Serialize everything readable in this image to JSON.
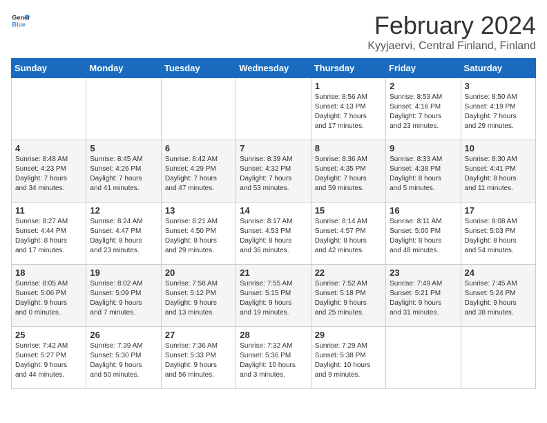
{
  "header": {
    "logo_line1": "General",
    "logo_line2": "Blue",
    "month_year": "February 2024",
    "location": "Kyyjaervi, Central Finland, Finland"
  },
  "weekdays": [
    "Sunday",
    "Monday",
    "Tuesday",
    "Wednesday",
    "Thursday",
    "Friday",
    "Saturday"
  ],
  "weeks": [
    [
      {
        "day": "",
        "info": ""
      },
      {
        "day": "",
        "info": ""
      },
      {
        "day": "",
        "info": ""
      },
      {
        "day": "",
        "info": ""
      },
      {
        "day": "1",
        "info": "Sunrise: 8:56 AM\nSunset: 4:13 PM\nDaylight: 7 hours\nand 17 minutes."
      },
      {
        "day": "2",
        "info": "Sunrise: 8:53 AM\nSunset: 4:16 PM\nDaylight: 7 hours\nand 23 minutes."
      },
      {
        "day": "3",
        "info": "Sunrise: 8:50 AM\nSunset: 4:19 PM\nDaylight: 7 hours\nand 29 minutes."
      }
    ],
    [
      {
        "day": "4",
        "info": "Sunrise: 8:48 AM\nSunset: 4:23 PM\nDaylight: 7 hours\nand 34 minutes."
      },
      {
        "day": "5",
        "info": "Sunrise: 8:45 AM\nSunset: 4:26 PM\nDaylight: 7 hours\nand 41 minutes."
      },
      {
        "day": "6",
        "info": "Sunrise: 8:42 AM\nSunset: 4:29 PM\nDaylight: 7 hours\nand 47 minutes."
      },
      {
        "day": "7",
        "info": "Sunrise: 8:39 AM\nSunset: 4:32 PM\nDaylight: 7 hours\nand 53 minutes."
      },
      {
        "day": "8",
        "info": "Sunrise: 8:36 AM\nSunset: 4:35 PM\nDaylight: 7 hours\nand 59 minutes."
      },
      {
        "day": "9",
        "info": "Sunrise: 8:33 AM\nSunset: 4:38 PM\nDaylight: 8 hours\nand 5 minutes."
      },
      {
        "day": "10",
        "info": "Sunrise: 8:30 AM\nSunset: 4:41 PM\nDaylight: 8 hours\nand 11 minutes."
      }
    ],
    [
      {
        "day": "11",
        "info": "Sunrise: 8:27 AM\nSunset: 4:44 PM\nDaylight: 8 hours\nand 17 minutes."
      },
      {
        "day": "12",
        "info": "Sunrise: 8:24 AM\nSunset: 4:47 PM\nDaylight: 8 hours\nand 23 minutes."
      },
      {
        "day": "13",
        "info": "Sunrise: 8:21 AM\nSunset: 4:50 PM\nDaylight: 8 hours\nand 29 minutes."
      },
      {
        "day": "14",
        "info": "Sunrise: 8:17 AM\nSunset: 4:53 PM\nDaylight: 8 hours\nand 36 minutes."
      },
      {
        "day": "15",
        "info": "Sunrise: 8:14 AM\nSunset: 4:57 PM\nDaylight: 8 hours\nand 42 minutes."
      },
      {
        "day": "16",
        "info": "Sunrise: 8:11 AM\nSunset: 5:00 PM\nDaylight: 8 hours\nand 48 minutes."
      },
      {
        "day": "17",
        "info": "Sunrise: 8:08 AM\nSunset: 5:03 PM\nDaylight: 8 hours\nand 54 minutes."
      }
    ],
    [
      {
        "day": "18",
        "info": "Sunrise: 8:05 AM\nSunset: 5:06 PM\nDaylight: 9 hours\nand 0 minutes."
      },
      {
        "day": "19",
        "info": "Sunrise: 8:02 AM\nSunset: 5:09 PM\nDaylight: 9 hours\nand 7 minutes."
      },
      {
        "day": "20",
        "info": "Sunrise: 7:58 AM\nSunset: 5:12 PM\nDaylight: 9 hours\nand 13 minutes."
      },
      {
        "day": "21",
        "info": "Sunrise: 7:55 AM\nSunset: 5:15 PM\nDaylight: 9 hours\nand 19 minutes."
      },
      {
        "day": "22",
        "info": "Sunrise: 7:52 AM\nSunset: 5:18 PM\nDaylight: 9 hours\nand 25 minutes."
      },
      {
        "day": "23",
        "info": "Sunrise: 7:49 AM\nSunset: 5:21 PM\nDaylight: 9 hours\nand 31 minutes."
      },
      {
        "day": "24",
        "info": "Sunrise: 7:45 AM\nSunset: 5:24 PM\nDaylight: 9 hours\nand 38 minutes."
      }
    ],
    [
      {
        "day": "25",
        "info": "Sunrise: 7:42 AM\nSunset: 5:27 PM\nDaylight: 9 hours\nand 44 minutes."
      },
      {
        "day": "26",
        "info": "Sunrise: 7:39 AM\nSunset: 5:30 PM\nDaylight: 9 hours\nand 50 minutes."
      },
      {
        "day": "27",
        "info": "Sunrise: 7:36 AM\nSunset: 5:33 PM\nDaylight: 9 hours\nand 56 minutes."
      },
      {
        "day": "28",
        "info": "Sunrise: 7:32 AM\nSunset: 5:36 PM\nDaylight: 10 hours\nand 3 minutes."
      },
      {
        "day": "29",
        "info": "Sunrise: 7:29 AM\nSunset: 5:38 PM\nDaylight: 10 hours\nand 9 minutes."
      },
      {
        "day": "",
        "info": ""
      },
      {
        "day": "",
        "info": ""
      }
    ]
  ]
}
